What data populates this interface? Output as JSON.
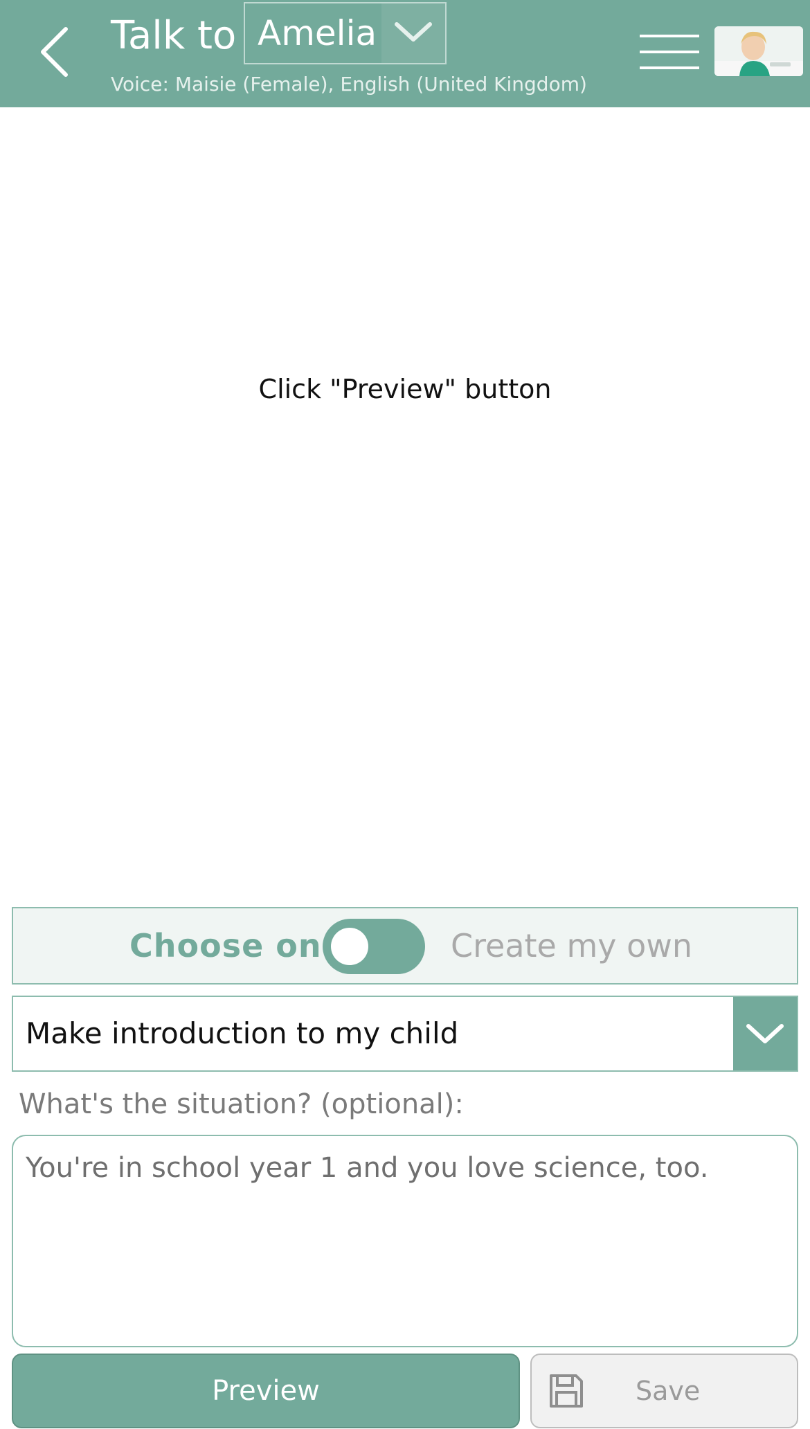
{
  "header": {
    "back_icon": "chevron-left-icon",
    "title_prefix": "Talk to",
    "agent_name": "Amelia",
    "agent_chevron_icon": "chevron-down-icon",
    "voice_info": "Voice: Maisie (Female), English (United Kingdom)",
    "menu_icon": "hamburger-menu-icon",
    "avatar": "child-photo-avatar"
  },
  "main": {
    "preview_message": "Click \"Preview\" button"
  },
  "mode": {
    "choose_label": "Choose one",
    "create_label": "Create my own",
    "toggle_state": "choose-one"
  },
  "topic": {
    "selected": "Make introduction to my child",
    "arrow_icon": "chevron-down-icon"
  },
  "situation": {
    "label": "What's the situation? (optional):",
    "value": "You're in school year 1 and you love science, too."
  },
  "actions": {
    "preview_label": "Preview",
    "save_label": "Save",
    "save_icon": "floppy-disk-icon"
  },
  "colors": {
    "accent": "#73aa9b",
    "panel_bg": "#f0f5f3",
    "border": "#8dbcae"
  }
}
